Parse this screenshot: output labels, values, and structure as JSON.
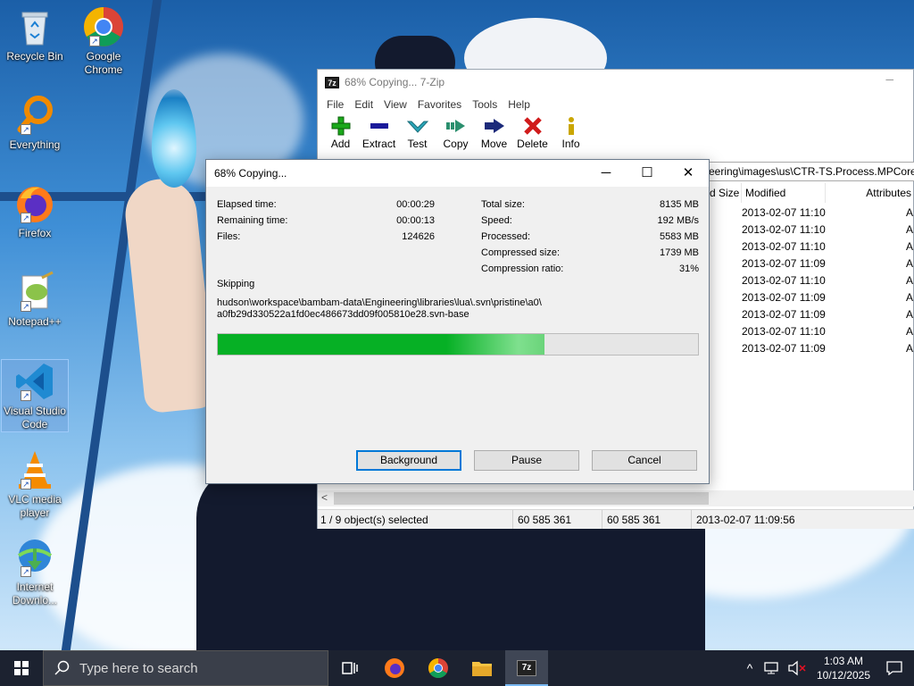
{
  "desktop": {
    "icons": [
      {
        "label": "Recycle Bin",
        "icon": "recycle-bin-icon"
      },
      {
        "label": "Google Chrome",
        "icon": "chrome-icon"
      },
      {
        "label": "Everything",
        "icon": "everything-search-icon"
      },
      {
        "label": "Firefox",
        "icon": "firefox-icon"
      },
      {
        "label": "Notepad++",
        "icon": "notepadpp-icon"
      },
      {
        "label": "Visual Studio Code",
        "icon": "vscode-icon"
      },
      {
        "label": "VLC media player",
        "icon": "vlc-icon"
      },
      {
        "label": "Internet Downlo...",
        "icon": "idm-icon"
      }
    ]
  },
  "zip_window": {
    "title": "68% Copying... 7-Zip",
    "app_icon_text": "7z",
    "menu": [
      "File",
      "Edit",
      "View",
      "Favorites",
      "Tools",
      "Help"
    ],
    "toolbar": [
      {
        "label": "Add",
        "icon": "plus-icon",
        "color": "#1aa81a"
      },
      {
        "label": "Extract",
        "icon": "minus-icon",
        "color": "#1a1a9a"
      },
      {
        "label": "Test",
        "icon": "check-icon",
        "color": "#2aa6b8"
      },
      {
        "label": "Copy",
        "icon": "copy-arrow-icon",
        "color": "#2b8f6e"
      },
      {
        "label": "Move",
        "icon": "move-arrow-icon",
        "color": "#1c2a7a"
      },
      {
        "label": "Delete",
        "icon": "delete-x-icon",
        "color": "#d01b1b"
      },
      {
        "label": "Info",
        "icon": "info-icon",
        "color": "#caa600"
      }
    ],
    "path": "eering\\images\\us\\CTR-TS.Process.MPCore.",
    "columns": [
      "d Size",
      "Modified",
      "Attributes"
    ],
    "rows": [
      {
        "modified": "2013-02-07 11:10",
        "attr": "A"
      },
      {
        "modified": "2013-02-07 11:10",
        "attr": "A"
      },
      {
        "modified": "2013-02-07 11:10",
        "attr": "A"
      },
      {
        "modified": "2013-02-07 11:09",
        "attr": "A"
      },
      {
        "modified": "2013-02-07 11:10",
        "attr": "A"
      },
      {
        "modified": "2013-02-07 11:09",
        "attr": "A"
      },
      {
        "modified": "2013-02-07 11:09",
        "attr": "A"
      },
      {
        "modified": "2013-02-07 11:10",
        "attr": "A"
      },
      {
        "modified": "2013-02-07 11:09",
        "attr": "A"
      }
    ],
    "status": {
      "selection": "1 / 9 object(s) selected",
      "size": "60 585 361",
      "packed": "60 585 361",
      "modified": "2013-02-07 11:09:56"
    }
  },
  "dialog": {
    "title": "68% Copying...",
    "minimize": "─",
    "maximize": "☐",
    "close": "✕",
    "left_stats": [
      {
        "label": "Elapsed time:",
        "value": "00:00:29"
      },
      {
        "label": "Remaining time:",
        "value": "00:00:13"
      },
      {
        "label": "Files:",
        "value": "124626"
      }
    ],
    "right_stats": [
      {
        "label": "Total size:",
        "value": "8135 MB"
      },
      {
        "label": "Speed:",
        "value": "192 MB/s"
      },
      {
        "label": "Processed:",
        "value": "5583 MB"
      },
      {
        "label": "Compressed size:",
        "value": "1739 MB"
      },
      {
        "label": "Compression ratio:",
        "value": "31%"
      }
    ],
    "operation": "Skipping",
    "file_line1": "hudson\\workspace\\bambam-data\\Engineering\\libraries\\lua\\.svn\\pristine\\a0\\",
    "file_line2": "a0fb29d330522a1fd0ec486673dd09f005810e28.svn-base",
    "progress_fraction": 0.68,
    "buttons": {
      "background": "Background",
      "pause": "Pause",
      "cancel": "Cancel"
    }
  },
  "taskbar": {
    "search_placeholder": "Type here to search",
    "time": "1:03 AM",
    "date": "10/12/2025",
    "apps": [
      "task-view-icon",
      "firefox-icon",
      "chrome-icon",
      "file-explorer-icon",
      "7zip-icon"
    ]
  }
}
